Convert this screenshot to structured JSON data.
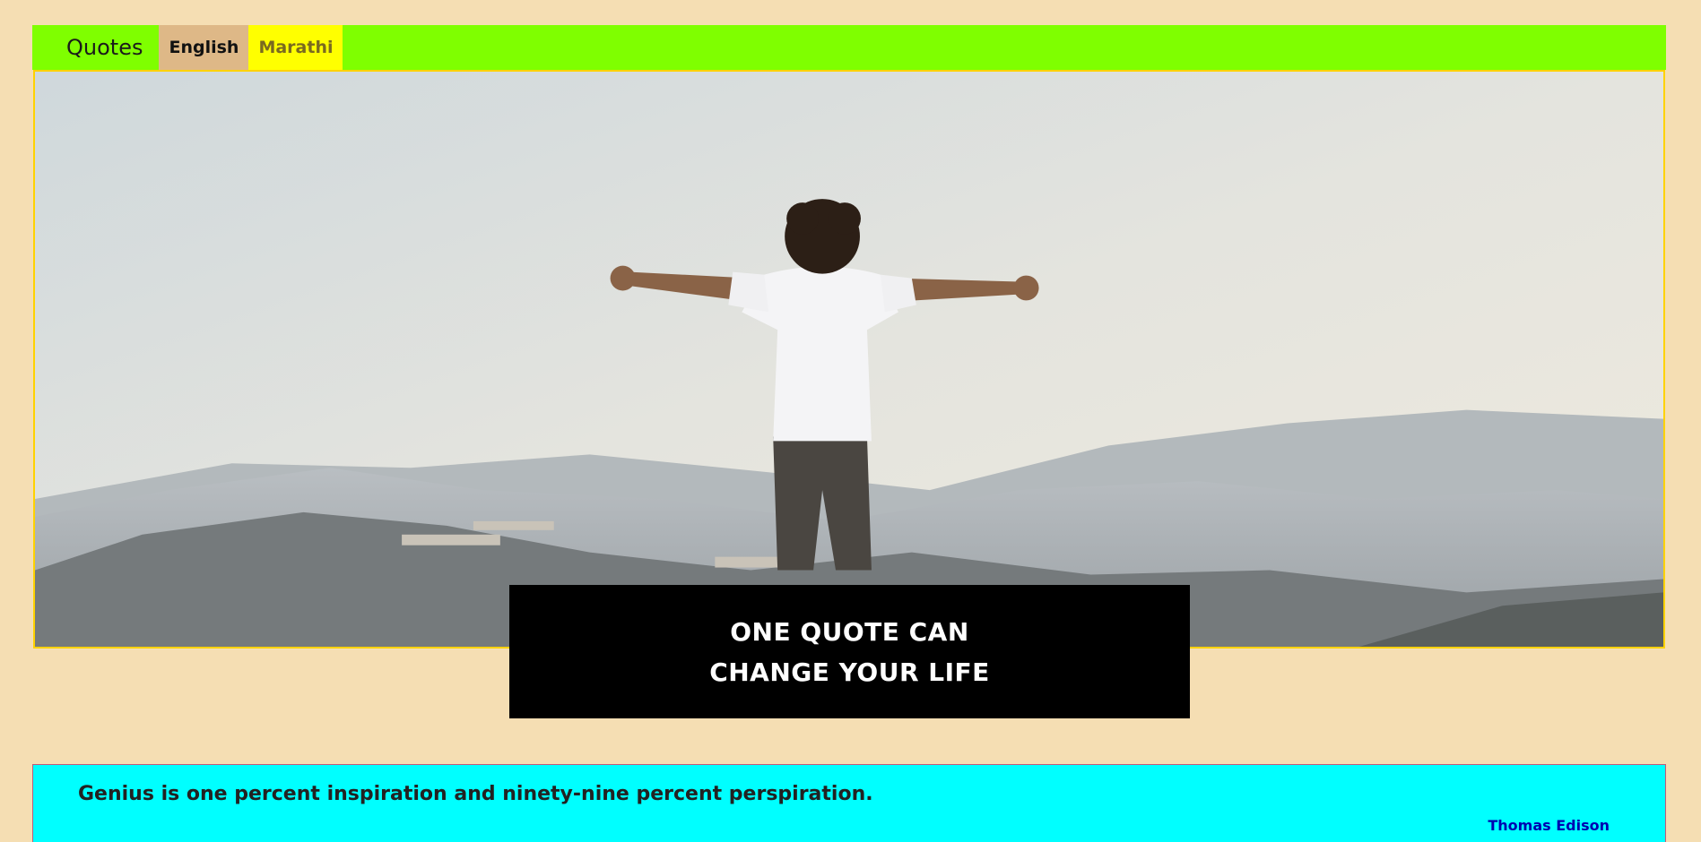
{
  "navbar": {
    "brand": "Quotes",
    "items": [
      {
        "label": "English"
      },
      {
        "label": "Marathi"
      }
    ]
  },
  "hero": {
    "image": "hero-image-person-arms-outstretched-on-mountain",
    "caption_line1": "ONE QUOTE CAN",
    "caption_line2": "CHANGE YOUR LIFE"
  },
  "quotes": [
    {
      "text": "Genius is one percent inspiration and ninety-nine percent perspiration.",
      "author": "Thomas Edison"
    }
  ],
  "colors": {
    "page_background": "#f5deb3",
    "navbar": "#7fff00",
    "english_tab": "#deb887",
    "marathi_tab": "#ffff00",
    "quote_card": "#00ffff",
    "author": "#0000b0"
  }
}
